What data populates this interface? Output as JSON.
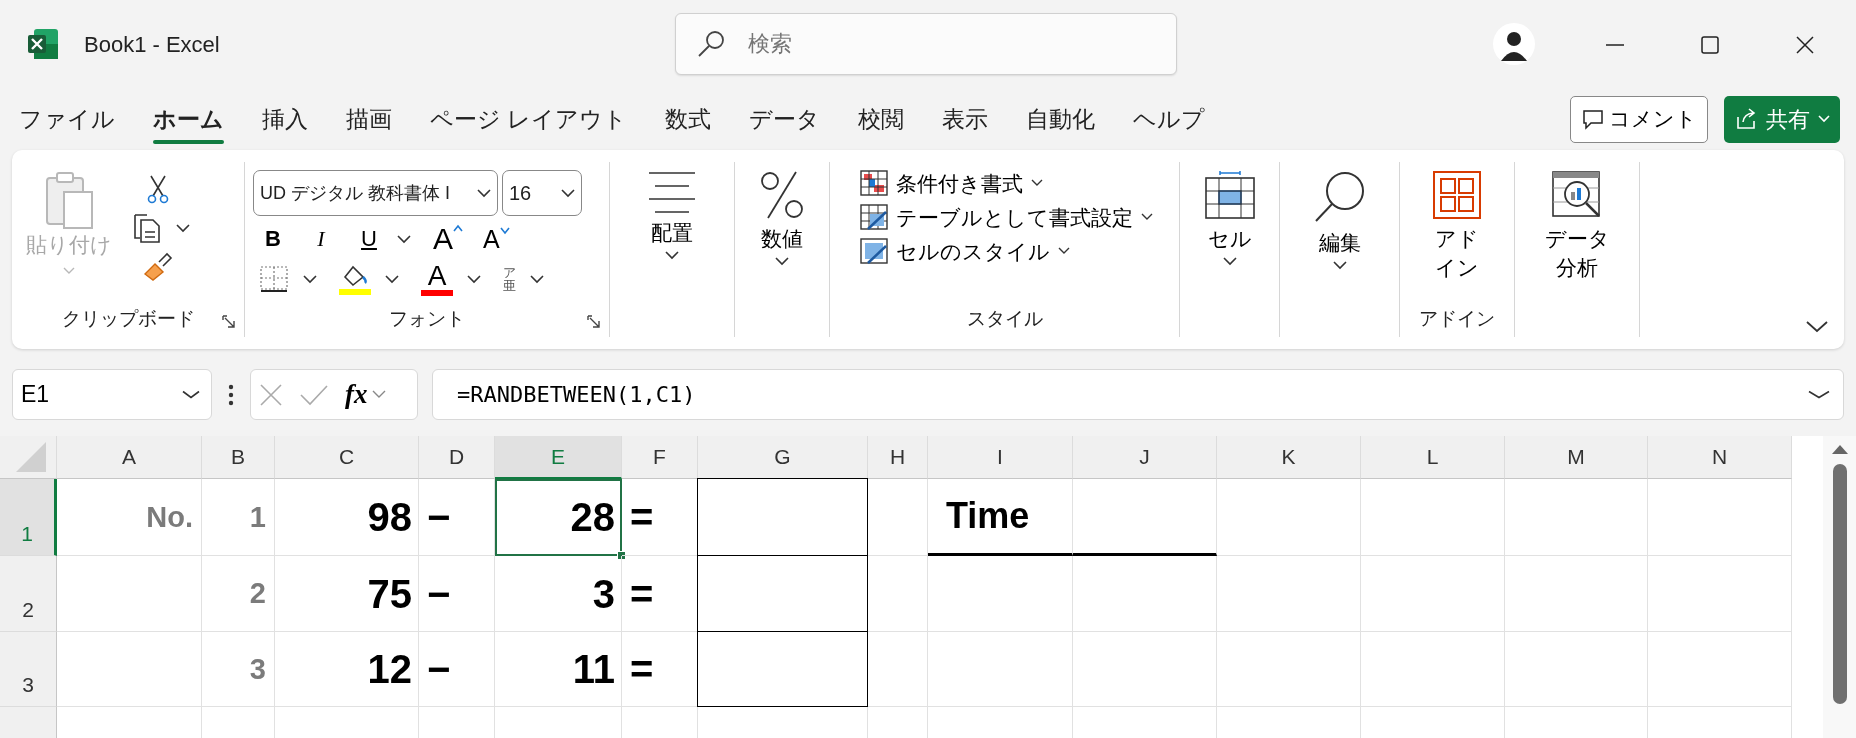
{
  "window": {
    "title": "Book1  -  Excel"
  },
  "search": {
    "placeholder": "検索"
  },
  "menu_tabs": [
    {
      "label": "ファイル",
      "selected": false
    },
    {
      "label": "ホーム",
      "selected": true
    },
    {
      "label": "挿入",
      "selected": false
    },
    {
      "label": "描画",
      "selected": false
    },
    {
      "label": "ページ レイアウト",
      "selected": false
    },
    {
      "label": "数式",
      "selected": false
    },
    {
      "label": "データ",
      "selected": false
    },
    {
      "label": "校閲",
      "selected": false
    },
    {
      "label": "表示",
      "selected": false
    },
    {
      "label": "自動化",
      "selected": false
    },
    {
      "label": "ヘルプ",
      "selected": false
    }
  ],
  "comment_button": "コメント",
  "share_button": "共有",
  "ribbon": {
    "clipboard": {
      "paste_label": "貼り付け",
      "paste_disabled": true,
      "group_label": "クリップボード"
    },
    "font": {
      "font_name": "UD デジタル 教科書体 I",
      "font_size": "16",
      "format_buttons": [
        {
          "label": "B",
          "kind": "bold"
        },
        {
          "label": "I",
          "kind": "italic"
        },
        {
          "label": "U",
          "kind": "underline"
        }
      ],
      "grow_label": "A",
      "shrink_label": "A",
      "font_color_label": "A",
      "phonetic_top": "ア",
      "phonetic_bottom": "亜",
      "group_label": "フォント"
    },
    "alignment": {
      "label": "配置"
    },
    "number": {
      "label": "数値"
    },
    "styles": {
      "items": [
        "条件付き書式",
        "テーブルとして書式設定",
        "セルのスタイル"
      ],
      "group_label": "スタイル"
    },
    "cells": {
      "label": "セル"
    },
    "editing": {
      "label": "編集"
    },
    "addins": {
      "label_lines": [
        "アド",
        "イン"
      ],
      "group_label": "アドイン"
    },
    "analysis": {
      "label_lines": [
        "データ",
        "分析"
      ]
    }
  },
  "formula_bar": {
    "name_box": "E1",
    "fx": "fx",
    "formula": "=RANDBETWEEN(1,C1)"
  },
  "columns": [
    {
      "label": "A",
      "selected": false
    },
    {
      "label": "B",
      "selected": false
    },
    {
      "label": "C",
      "selected": false
    },
    {
      "label": "D",
      "selected": false
    },
    {
      "label": "E",
      "selected": true
    },
    {
      "label": "F",
      "selected": false
    },
    {
      "label": "G",
      "selected": false
    },
    {
      "label": "H",
      "selected": false
    },
    {
      "label": "I",
      "selected": false
    },
    {
      "label": "J",
      "selected": false
    },
    {
      "label": "K",
      "selected": false
    },
    {
      "label": "L",
      "selected": false
    },
    {
      "label": "M",
      "selected": false
    },
    {
      "label": "N",
      "selected": false
    }
  ],
  "rows": [
    {
      "label": "1",
      "selected": true,
      "cells": [
        {
          "text": "No.",
          "kind": "label"
        },
        {
          "text": "1",
          "kind": "label"
        },
        {
          "text": "98",
          "kind": "value"
        },
        {
          "text": "−",
          "kind": "operator"
        },
        {
          "text": "28",
          "kind": "value",
          "selected": true
        },
        {
          "text": "=",
          "kind": "operator"
        },
        {
          "kind": "answer",
          "boxed": true
        },
        {},
        {
          "text": "Time",
          "kind": "heading",
          "underlined": true
        },
        {
          "underlined": true
        },
        {},
        {},
        {},
        {}
      ]
    },
    {
      "label": "2",
      "selected": false,
      "cells": [
        {},
        {
          "text": "2",
          "kind": "label"
        },
        {
          "text": "75",
          "kind": "value"
        },
        {
          "text": "−",
          "kind": "operator"
        },
        {
          "text": "3",
          "kind": "value"
        },
        {
          "text": "=",
          "kind": "operator"
        },
        {
          "kind": "answer",
          "boxed": true
        },
        {},
        {},
        {},
        {},
        {},
        {},
        {}
      ]
    },
    {
      "label": "3",
      "selected": false,
      "cells": [
        {},
        {
          "text": "3",
          "kind": "label"
        },
        {
          "text": "12",
          "kind": "value"
        },
        {
          "text": "−",
          "kind": "operator"
        },
        {
          "text": "11",
          "kind": "value"
        },
        {
          "text": "=",
          "kind": "operator"
        },
        {
          "kind": "answer",
          "boxed": true
        },
        {},
        {},
        {},
        {},
        {},
        {},
        {}
      ]
    }
  ]
}
